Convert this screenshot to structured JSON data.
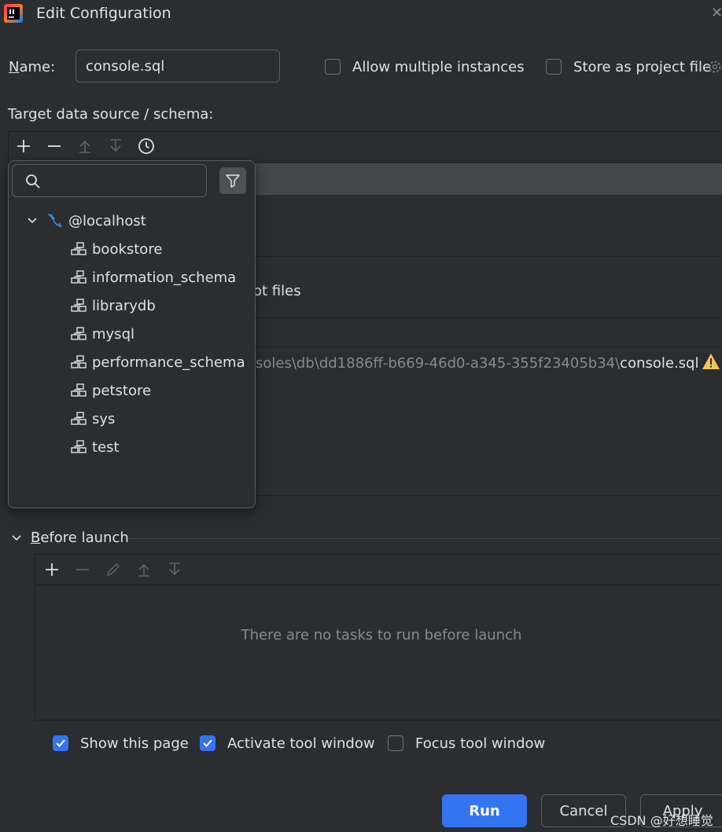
{
  "window": {
    "title": "Edit Configuration"
  },
  "form": {
    "name_label_accel": "N",
    "name_label_rest": "ame:",
    "name_value": "console.sql",
    "allow_multiple_label": "Allow multiple instances",
    "allow_multiple_checked": false,
    "store_project_label": "Store as project file",
    "store_project_checked": false,
    "target_label": "Target data source / schema:"
  },
  "behind_text": {
    "files_fragment": "ot files",
    "path_dim": "soles\\db\\dd1886ff-b669-46d0-a345-355f23405b34\\",
    "path_file": "console.sql"
  },
  "popup": {
    "search_placeholder": "",
    "root": "@localhost",
    "schemas": [
      "bookstore",
      "information_schema",
      "librarydb",
      "mysql",
      "performance_schema",
      "petstore",
      "sys",
      "test"
    ]
  },
  "before_launch": {
    "accel": "B",
    "rest": "efore launch",
    "empty_message": "There are no tasks to run before launch"
  },
  "options": {
    "show_page_label": "Show this page",
    "show_page_checked": true,
    "activate_tool_label": "Activate tool window",
    "activate_tool_checked": true,
    "focus_tool_label": "Focus tool window",
    "focus_tool_checked": false
  },
  "buttons": {
    "run": "Run",
    "cancel": "Cancel",
    "apply": "Apply"
  },
  "watermark": "CSDN @好想睡觉",
  "colors": {
    "background": "#2b2d30",
    "accent": "#3574f0",
    "mysql_icon": "#3d8fd1",
    "warning": "#f2c55c"
  },
  "icons": {
    "add": "plus-icon",
    "remove": "minus-icon",
    "move_up": "arrow-up-icon",
    "move_down": "arrow-down-icon",
    "history": "clock-icon",
    "search": "search-icon",
    "filter": "funnel-icon",
    "expand": "chevron-down-icon",
    "datasource": "mysql-dolphin-icon",
    "schema": "schema-icon",
    "edit": "pencil-icon",
    "warning": "warning-icon",
    "settings": "gear-icon"
  }
}
